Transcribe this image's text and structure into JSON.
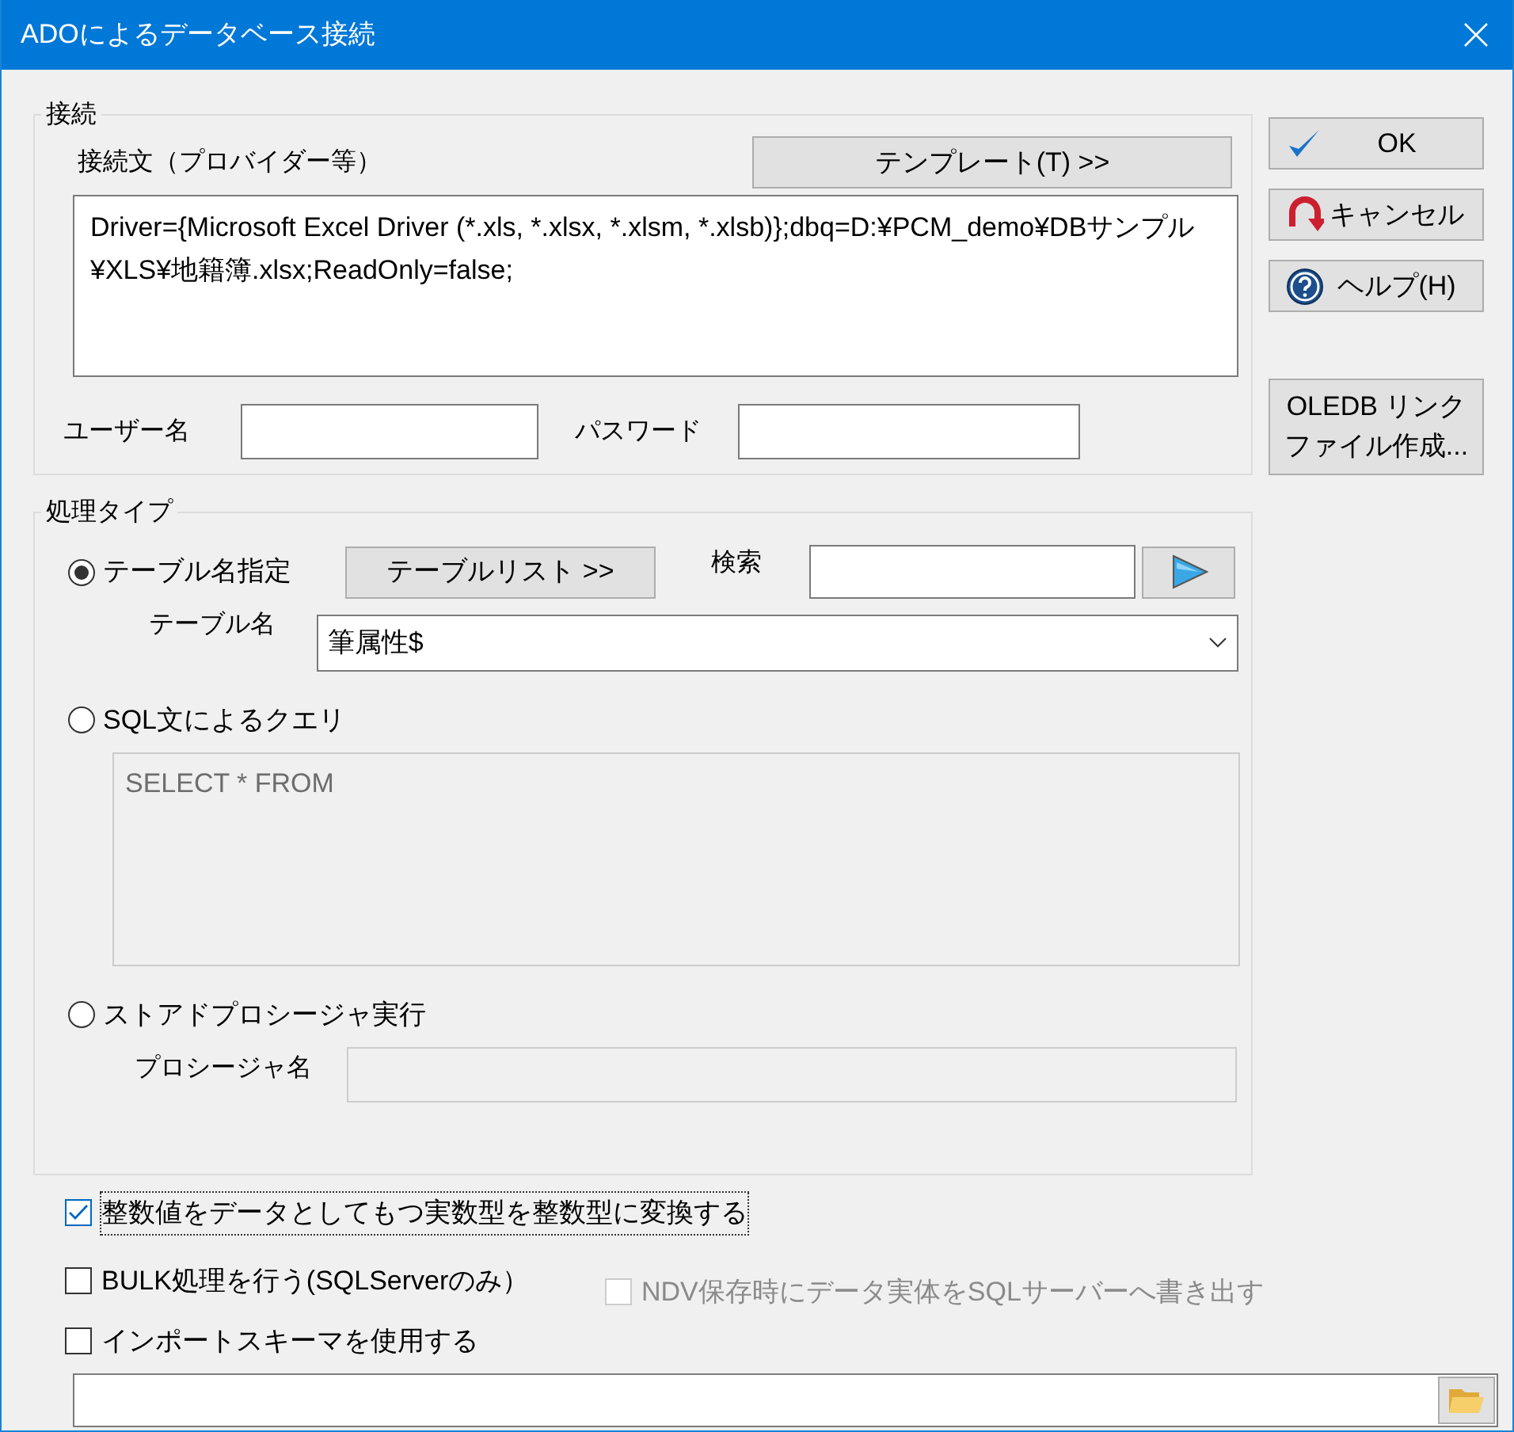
{
  "window": {
    "title": "ADOによるデータベース接続"
  },
  "connection": {
    "legend": "接続",
    "string_label": "接続文（プロバイダー等）",
    "template_button": "テンプレート(T) >>",
    "connection_string": "Driver={Microsoft Excel Driver (*.xls, *.xlsx, *.xlsm, *.xlsb)};dbq=D:¥PCM_demo¥DBサンプル¥XLS¥地籍簿.xlsx;ReadOnly=false;",
    "user_label": "ユーザー名",
    "password_label": "パスワード"
  },
  "processing": {
    "legend": "処理タイプ",
    "table_list_button": "テーブルリスト >>",
    "search_label": "検索",
    "table_name_label": "テーブル名",
    "table_name_value": "筆属性$",
    "sql_text": "SELECT * FROM",
    "sql_disabled": true,
    "procedure_label": "プロシージャ名",
    "procedure_disabled": true,
    "options": [
      {
        "kind": "table",
        "label": "テーブル名指定",
        "selected": true
      },
      {
        "kind": "sql",
        "label": "SQL文によるクエリ",
        "selected": false
      },
      {
        "kind": "procedure",
        "label": "ストアドプロシージャ実行",
        "selected": false
      }
    ]
  },
  "checkboxes": [
    {
      "label": "整数値をデータとしてもつ実数型を整数型に変換する",
      "checked": true,
      "disabled": false,
      "focused": true
    },
    {
      "label": "BULK処理を行う(SQLServerのみ）",
      "checked": false,
      "disabled": false,
      "focused": false
    },
    {
      "label": "NDV保存時にデータ実体をSQLサーバーへ書き出す",
      "checked": false,
      "disabled": true,
      "focused": false
    },
    {
      "label": "インポートスキーマを使用する",
      "checked": false,
      "disabled": false,
      "focused": false
    }
  ],
  "buttons": [
    {
      "kind": "ok",
      "label": "OK"
    },
    {
      "kind": "cancel",
      "label": "キャンセル"
    },
    {
      "kind": "help",
      "label": "ヘルプ(H)"
    },
    {
      "kind": "oledb",
      "lines": [
        "OLEDB リンク",
        "ファイル作成..."
      ]
    }
  ]
}
